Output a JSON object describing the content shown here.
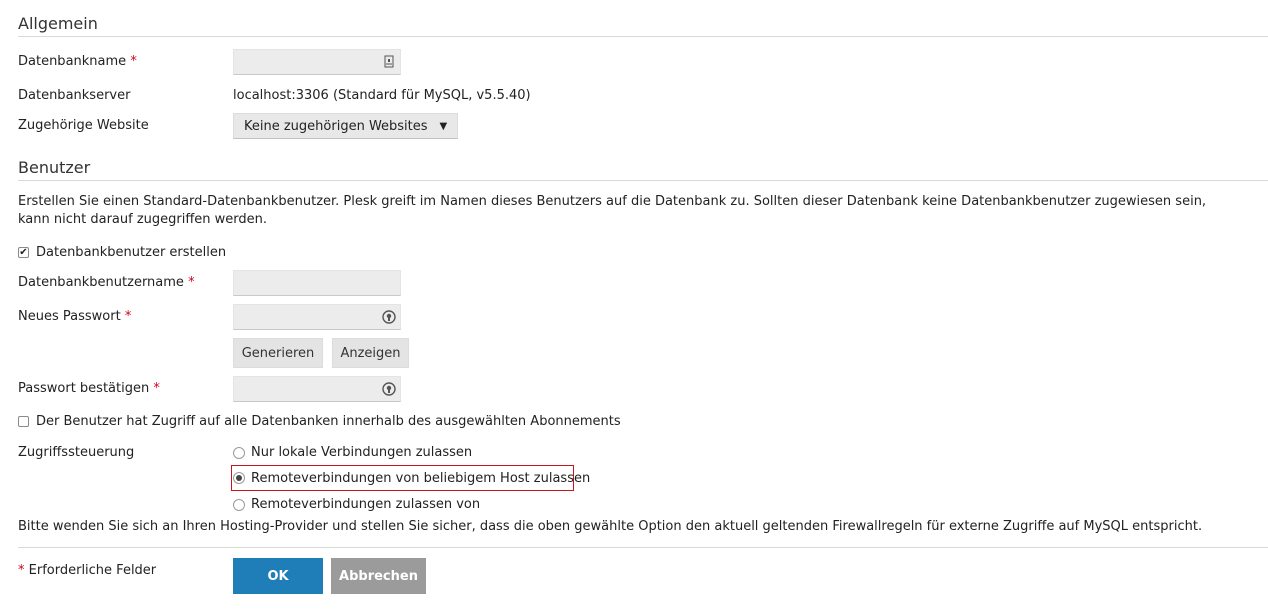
{
  "general": {
    "title": "Allgemein",
    "db_name_label": "Datenbankname",
    "db_name_value": "",
    "db_server_label": "Datenbankserver",
    "db_server_value": "localhost:3306 (Standard für MySQL, v5.5.40)",
    "website_label": "Zugehörige Website",
    "website_selected": "Keine zugehörigen Websites"
  },
  "users": {
    "title": "Benutzer",
    "description": "Erstellen Sie einen Standard-Datenbankbenutzer. Plesk greift im Namen dieses Benutzers auf die Datenbank zu. Sollten dieser Datenbank keine Datenbankbenutzer zugewiesen sein, kann nicht darauf zugegriffen werden.",
    "create_user_label": "Datenbankbenutzer erstellen",
    "create_user_checked": true,
    "username_label": "Datenbankbenutzername",
    "username_value": "",
    "password_label": "Neues Passwort",
    "password_value": "",
    "generate_label": "Generieren",
    "show_label": "Anzeigen",
    "confirm_label": "Passwort bestätigen",
    "confirm_value": "",
    "all_dbs_label": "Der Benutzer hat Zugriff auf alle Datenbanken innerhalb des ausgewählten Abonnements",
    "all_dbs_checked": false,
    "access_label": "Zugriffssteuerung",
    "access_options": [
      "Nur lokale Verbindungen zulassen",
      "Remoteverbindungen von beliebigem Host zulassen",
      "Remoteverbindungen zulassen von"
    ],
    "access_selected_index": 1,
    "firewall_note": "Bitte wenden Sie sich an Ihren Hosting-Provider und stellen Sie sicher, dass die oben gewählte Option den aktuell geltenden Firewallregeln für externe Zugriffe auf MySQL entspricht."
  },
  "footer": {
    "required_marker": "*",
    "required_text": "Erforderliche Felder",
    "ok_label": "OK",
    "cancel_label": "Abbrechen"
  },
  "icons": {
    "db_name_field": "field-helper-icon",
    "password_field": "password-strength-icon",
    "select_caret": "caret-down-icon"
  },
  "colors": {
    "required": "#d0021b",
    "primary_button": "#1f7eb8",
    "cancel_button": "#9b9b9b",
    "highlight": "#c4161c"
  }
}
